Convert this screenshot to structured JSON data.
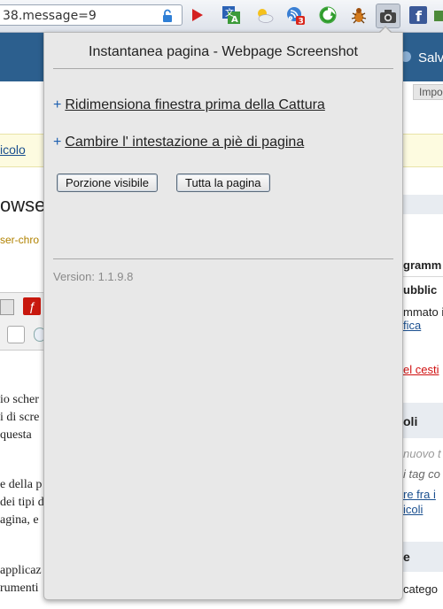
{
  "toolbar": {
    "url_text": "38.message=9",
    "icons": [
      "translate-icon",
      "weather-icon",
      "rss-icon",
      "refresh-icon",
      "bug-icon",
      "camera-icon",
      "facebook-icon",
      "puzzle-icon"
    ],
    "rss_badge": "3"
  },
  "background_page": {
    "header_button": "Salv",
    "impo_tab": "Impo",
    "link_left": "icolo",
    "heading_fragment": "owse",
    "url_fragment": "ser-chro",
    "text_lines": [
      "io scher",
      "i di scre",
      "questa",
      "e della p",
      "dei tipi d",
      "agina, e",
      "applicaz",
      "rumenti"
    ],
    "right_lines": [
      "gramm",
      "ubblic",
      "mmato i",
      "fica",
      "el cesti",
      "oli",
      "nuovo t",
      "i tag co",
      "re fra i",
      "icoli",
      "e",
      "catego"
    ]
  },
  "popup": {
    "title": "Instantanea pagina - Webpage Screenshot",
    "options": [
      {
        "plus": "+",
        "label": "Ridimensiona finestra prima della Cattura"
      },
      {
        "plus": "+",
        "label": "Cambire l' intestazione a piè di pagina"
      }
    ],
    "buttons": {
      "visible": "Porzione visibile",
      "full": "Tutta la pagina"
    },
    "version": "Version: 1.1.9.8"
  },
  "colors": {
    "popup_bg": "#e8e8e8",
    "header_blue": "#2c5f8e",
    "plus_blue": "#1d5fb0"
  }
}
